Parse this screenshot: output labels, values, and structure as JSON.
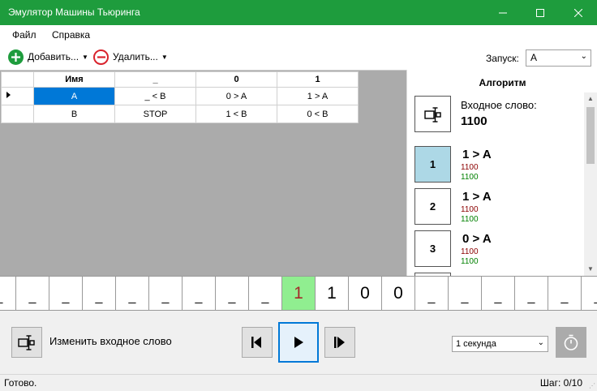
{
  "window": {
    "title": "Эмулятор Машины Тьюринга"
  },
  "menu": {
    "file": "Файл",
    "help": "Справка"
  },
  "toolbar": {
    "add_label": "Добавить...",
    "remove_label": "Удалить...",
    "run_label": "Запуск:",
    "run_value": "A"
  },
  "table": {
    "headers": [
      "Имя",
      "_",
      "0",
      "1"
    ],
    "rows": [
      {
        "name": "A",
        "blank": "_ < B",
        "zero": "0 > A",
        "one": "1 > A"
      },
      {
        "name": "B",
        "blank": "STOP",
        "zero": "1 < B",
        "one": "0 < B"
      }
    ]
  },
  "algorithm": {
    "title": "Алгоритм",
    "input_label": "Входное слово:",
    "input_value": "1100",
    "steps": [
      {
        "num": "1",
        "rule": "1 > A",
        "before": "1100",
        "after": "1100"
      },
      {
        "num": "2",
        "rule": "1 > A",
        "before": "1100",
        "after": "1100"
      },
      {
        "num": "3",
        "rule": "0 > A",
        "before": "1100",
        "after": "1100"
      }
    ]
  },
  "tape": {
    "cells": [
      "_",
      "_",
      "_",
      "_",
      "_",
      "_",
      "_",
      "_",
      "1",
      "1",
      "0",
      "0",
      "_",
      "_",
      "_",
      "_",
      "_",
      "_"
    ]
  },
  "controls": {
    "change_word_label": "Изменить входное слово",
    "speed_value": "1 секунда"
  },
  "status": {
    "text": "Готово.",
    "step_counter": "Шаг: 0/10"
  }
}
